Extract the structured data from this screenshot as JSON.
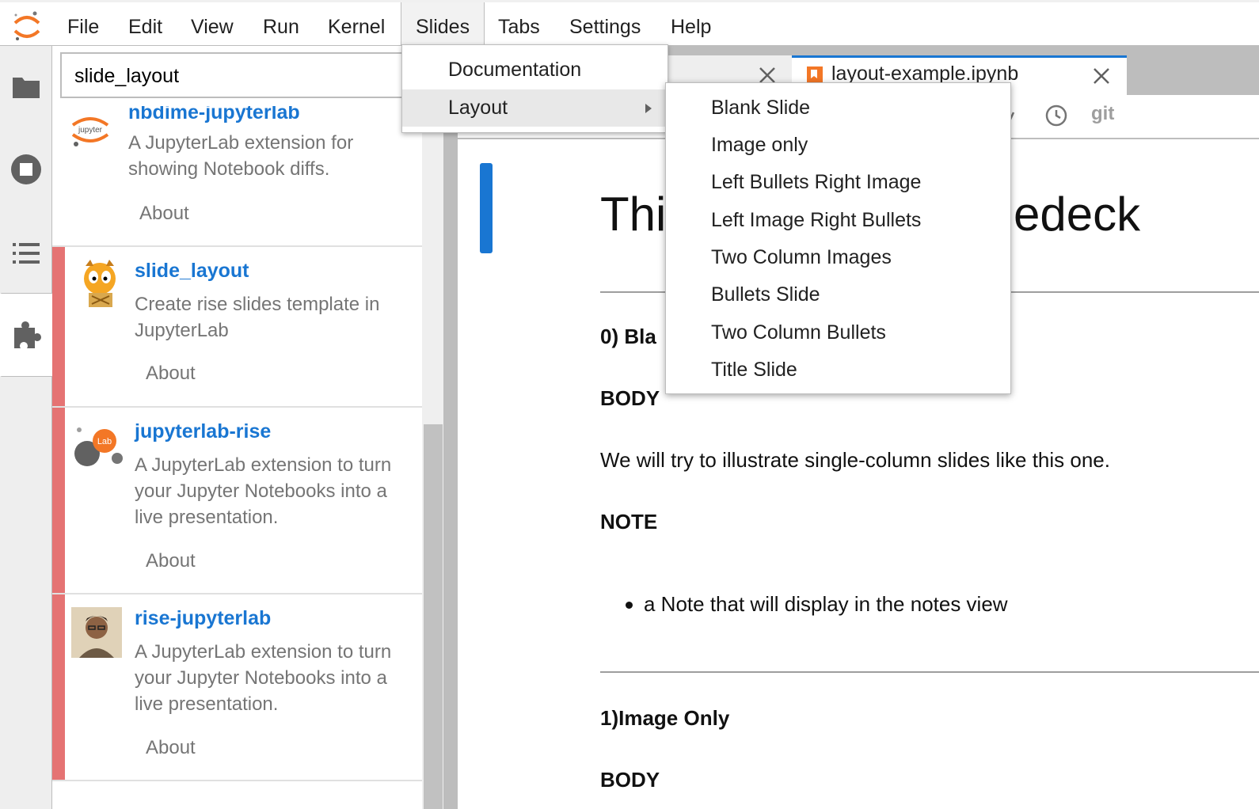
{
  "menubar": {
    "items": [
      "File",
      "Edit",
      "View",
      "Run",
      "Kernel",
      "Slides",
      "Tabs",
      "Settings",
      "Help"
    ]
  },
  "sidebar": {
    "search_value": "slide_layout",
    "extensions": [
      {
        "name": "nbdime-jupyterlab",
        "description": "A JupyterLab extension for showing Notebook diffs.",
        "about": "About",
        "logo_text": "jupyter"
      },
      {
        "name": "slide_layout",
        "description": "Create rise slides template in JupyterLab",
        "about": "About"
      },
      {
        "name": "jupyterlab-rise",
        "description": "A JupyterLab extension to turn your Jupyter Notebooks into a live presentation.",
        "about": "About",
        "logo_text": "Lab"
      },
      {
        "name": "rise-jupyterlab",
        "description": "A JupyterLab extension to turn your Jupyter Notebooks into a live presentation.",
        "about": "About"
      }
    ]
  },
  "tabs": {
    "active_label": "layout-example.ipynb"
  },
  "toolbar": {
    "git_label": "git"
  },
  "notebook": {
    "heading_left": "Thi",
    "heading_right": "edeck",
    "section0_label": "0) Bla",
    "body_label": "BODY",
    "body_text": "We will try to illustrate single-column slides like this one.",
    "note_label": "NOTE",
    "note_bullet": "a Note that will display in the notes view",
    "section1_label": "1)Image Only",
    "body_label2": "BODY"
  },
  "slides_menu": {
    "items": [
      "Documentation",
      "Layout"
    ]
  },
  "layout_submenu": {
    "items": [
      "Blank Slide",
      "Image only",
      "Left Bullets Right Image",
      "Left Image Right Bullets",
      "Two Column Images",
      "Bullets Slide",
      "Two Column Bullets",
      "Title Slide"
    ]
  }
}
